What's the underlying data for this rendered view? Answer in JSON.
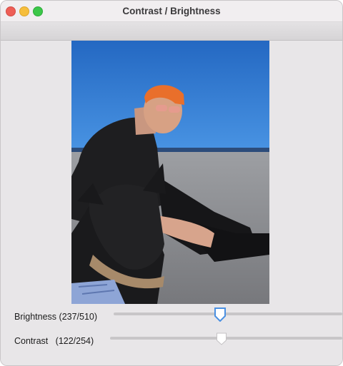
{
  "window": {
    "title": "Contrast / Brightness"
  },
  "image": {
    "subject": "man-with-dog-on-beach"
  },
  "brightness": {
    "label": "Brightness (237/510)",
    "value": 237,
    "max": 510
  },
  "contrast": {
    "label": "Contrast   (122/254)",
    "value": 122,
    "max": 254
  },
  "colors": {
    "accent": "#4a90e2",
    "close": "#ee5e56",
    "minimize": "#f6be3c",
    "zoom": "#3cc749"
  }
}
